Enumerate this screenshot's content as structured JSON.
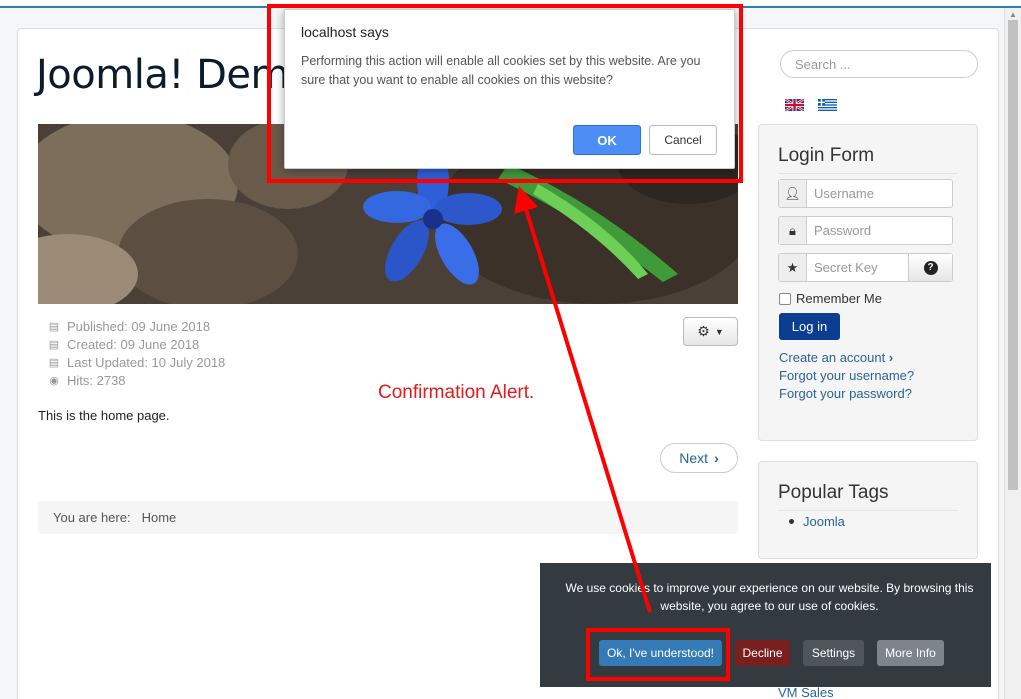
{
  "site": {
    "title": "Joomla! Demo"
  },
  "article": {
    "meta": [
      {
        "icon": "calendar-icon",
        "text": "Published: 09 June 2018"
      },
      {
        "icon": "calendar-icon",
        "text": "Created: 09 June 2018"
      },
      {
        "icon": "calendar-icon",
        "text": "Last Updated: 10 July 2018"
      },
      {
        "icon": "eye-icon",
        "text": "Hits: 2738"
      }
    ],
    "body": "This is the home page.",
    "next_label": "Next"
  },
  "breadcrumb": {
    "prefix": "You are here:",
    "home": "Home"
  },
  "sidebar": {
    "search_placeholder": "Search ...",
    "login": {
      "title": "Login Form",
      "username_placeholder": "Username",
      "password_placeholder": "Password",
      "secret_placeholder": "Secret Key",
      "remember_label": "Remember Me",
      "login_button": "Log in",
      "create_account": "Create an account",
      "forgot_username": "Forgot your username?",
      "forgot_password": "Forgot your password?"
    },
    "tags": {
      "title": "Popular Tags",
      "items": [
        "Joomla"
      ]
    },
    "vm_sales": "VM Sales"
  },
  "annotation": {
    "label": "Confirmation Alert.",
    "color": "#e3191b"
  },
  "cookie_bar": {
    "message": "We use cookies to improve your experience on our website. By browsing this website, you agree to our use of cookies.",
    "ok": "Ok, I've understood!",
    "decline": "Decline",
    "settings": "Settings",
    "more_info": "More Info"
  },
  "dialog": {
    "title": "localhost says",
    "message": "Performing this action will enable all cookies set by this website. Are you sure that you want to enable all cookies on this website?",
    "ok": "OK",
    "cancel": "Cancel"
  },
  "colors": {
    "accent": "#2a7fbd",
    "login_btn": "#0b3d91",
    "highlight": "#ff0000"
  }
}
